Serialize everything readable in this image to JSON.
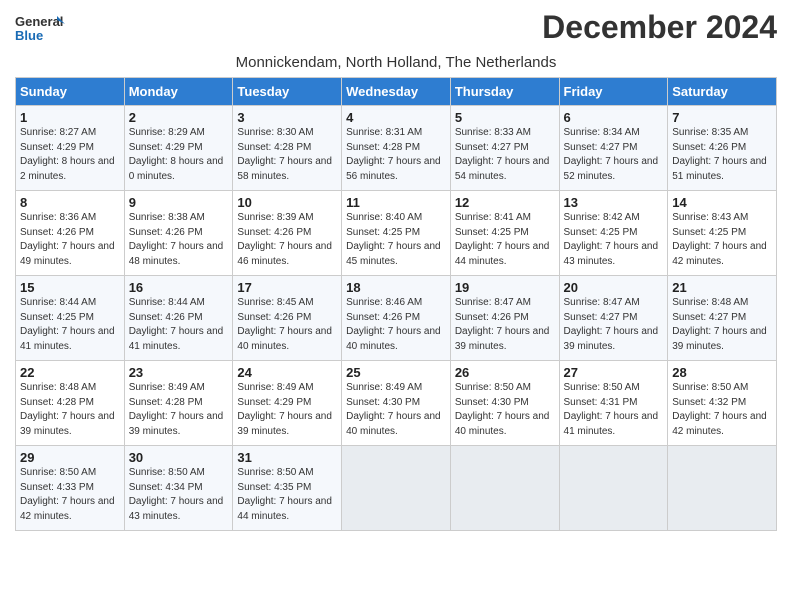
{
  "header": {
    "logo_line1": "General",
    "logo_line2": "Blue",
    "month_year": "December 2024",
    "location": "Monnickendam, North Holland, The Netherlands"
  },
  "weekdays": [
    "Sunday",
    "Monday",
    "Tuesday",
    "Wednesday",
    "Thursday",
    "Friday",
    "Saturday"
  ],
  "weeks": [
    [
      {
        "day": "1",
        "sunrise": "Sunrise: 8:27 AM",
        "sunset": "Sunset: 4:29 PM",
        "daylight": "Daylight: 8 hours and 2 minutes."
      },
      {
        "day": "2",
        "sunrise": "Sunrise: 8:29 AM",
        "sunset": "Sunset: 4:29 PM",
        "daylight": "Daylight: 8 hours and 0 minutes."
      },
      {
        "day": "3",
        "sunrise": "Sunrise: 8:30 AM",
        "sunset": "Sunset: 4:28 PM",
        "daylight": "Daylight: 7 hours and 58 minutes."
      },
      {
        "day": "4",
        "sunrise": "Sunrise: 8:31 AM",
        "sunset": "Sunset: 4:28 PM",
        "daylight": "Daylight: 7 hours and 56 minutes."
      },
      {
        "day": "5",
        "sunrise": "Sunrise: 8:33 AM",
        "sunset": "Sunset: 4:27 PM",
        "daylight": "Daylight: 7 hours and 54 minutes."
      },
      {
        "day": "6",
        "sunrise": "Sunrise: 8:34 AM",
        "sunset": "Sunset: 4:27 PM",
        "daylight": "Daylight: 7 hours and 52 minutes."
      },
      {
        "day": "7",
        "sunrise": "Sunrise: 8:35 AM",
        "sunset": "Sunset: 4:26 PM",
        "daylight": "Daylight: 7 hours and 51 minutes."
      }
    ],
    [
      {
        "day": "8",
        "sunrise": "Sunrise: 8:36 AM",
        "sunset": "Sunset: 4:26 PM",
        "daylight": "Daylight: 7 hours and 49 minutes."
      },
      {
        "day": "9",
        "sunrise": "Sunrise: 8:38 AM",
        "sunset": "Sunset: 4:26 PM",
        "daylight": "Daylight: 7 hours and 48 minutes."
      },
      {
        "day": "10",
        "sunrise": "Sunrise: 8:39 AM",
        "sunset": "Sunset: 4:26 PM",
        "daylight": "Daylight: 7 hours and 46 minutes."
      },
      {
        "day": "11",
        "sunrise": "Sunrise: 8:40 AM",
        "sunset": "Sunset: 4:25 PM",
        "daylight": "Daylight: 7 hours and 45 minutes."
      },
      {
        "day": "12",
        "sunrise": "Sunrise: 8:41 AM",
        "sunset": "Sunset: 4:25 PM",
        "daylight": "Daylight: 7 hours and 44 minutes."
      },
      {
        "day": "13",
        "sunrise": "Sunrise: 8:42 AM",
        "sunset": "Sunset: 4:25 PM",
        "daylight": "Daylight: 7 hours and 43 minutes."
      },
      {
        "day": "14",
        "sunrise": "Sunrise: 8:43 AM",
        "sunset": "Sunset: 4:25 PM",
        "daylight": "Daylight: 7 hours and 42 minutes."
      }
    ],
    [
      {
        "day": "15",
        "sunrise": "Sunrise: 8:44 AM",
        "sunset": "Sunset: 4:25 PM",
        "daylight": "Daylight: 7 hours and 41 minutes."
      },
      {
        "day": "16",
        "sunrise": "Sunrise: 8:44 AM",
        "sunset": "Sunset: 4:26 PM",
        "daylight": "Daylight: 7 hours and 41 minutes."
      },
      {
        "day": "17",
        "sunrise": "Sunrise: 8:45 AM",
        "sunset": "Sunset: 4:26 PM",
        "daylight": "Daylight: 7 hours and 40 minutes."
      },
      {
        "day": "18",
        "sunrise": "Sunrise: 8:46 AM",
        "sunset": "Sunset: 4:26 PM",
        "daylight": "Daylight: 7 hours and 40 minutes."
      },
      {
        "day": "19",
        "sunrise": "Sunrise: 8:47 AM",
        "sunset": "Sunset: 4:26 PM",
        "daylight": "Daylight: 7 hours and 39 minutes."
      },
      {
        "day": "20",
        "sunrise": "Sunrise: 8:47 AM",
        "sunset": "Sunset: 4:27 PM",
        "daylight": "Daylight: 7 hours and 39 minutes."
      },
      {
        "day": "21",
        "sunrise": "Sunrise: 8:48 AM",
        "sunset": "Sunset: 4:27 PM",
        "daylight": "Daylight: 7 hours and 39 minutes."
      }
    ],
    [
      {
        "day": "22",
        "sunrise": "Sunrise: 8:48 AM",
        "sunset": "Sunset: 4:28 PM",
        "daylight": "Daylight: 7 hours and 39 minutes."
      },
      {
        "day": "23",
        "sunrise": "Sunrise: 8:49 AM",
        "sunset": "Sunset: 4:28 PM",
        "daylight": "Daylight: 7 hours and 39 minutes."
      },
      {
        "day": "24",
        "sunrise": "Sunrise: 8:49 AM",
        "sunset": "Sunset: 4:29 PM",
        "daylight": "Daylight: 7 hours and 39 minutes."
      },
      {
        "day": "25",
        "sunrise": "Sunrise: 8:49 AM",
        "sunset": "Sunset: 4:30 PM",
        "daylight": "Daylight: 7 hours and 40 minutes."
      },
      {
        "day": "26",
        "sunrise": "Sunrise: 8:50 AM",
        "sunset": "Sunset: 4:30 PM",
        "daylight": "Daylight: 7 hours and 40 minutes."
      },
      {
        "day": "27",
        "sunrise": "Sunrise: 8:50 AM",
        "sunset": "Sunset: 4:31 PM",
        "daylight": "Daylight: 7 hours and 41 minutes."
      },
      {
        "day": "28",
        "sunrise": "Sunrise: 8:50 AM",
        "sunset": "Sunset: 4:32 PM",
        "daylight": "Daylight: 7 hours and 42 minutes."
      }
    ],
    [
      {
        "day": "29",
        "sunrise": "Sunrise: 8:50 AM",
        "sunset": "Sunset: 4:33 PM",
        "daylight": "Daylight: 7 hours and 42 minutes."
      },
      {
        "day": "30",
        "sunrise": "Sunrise: 8:50 AM",
        "sunset": "Sunset: 4:34 PM",
        "daylight": "Daylight: 7 hours and 43 minutes."
      },
      {
        "day": "31",
        "sunrise": "Sunrise: 8:50 AM",
        "sunset": "Sunset: 4:35 PM",
        "daylight": "Daylight: 7 hours and 44 minutes."
      },
      null,
      null,
      null,
      null
    ]
  ]
}
